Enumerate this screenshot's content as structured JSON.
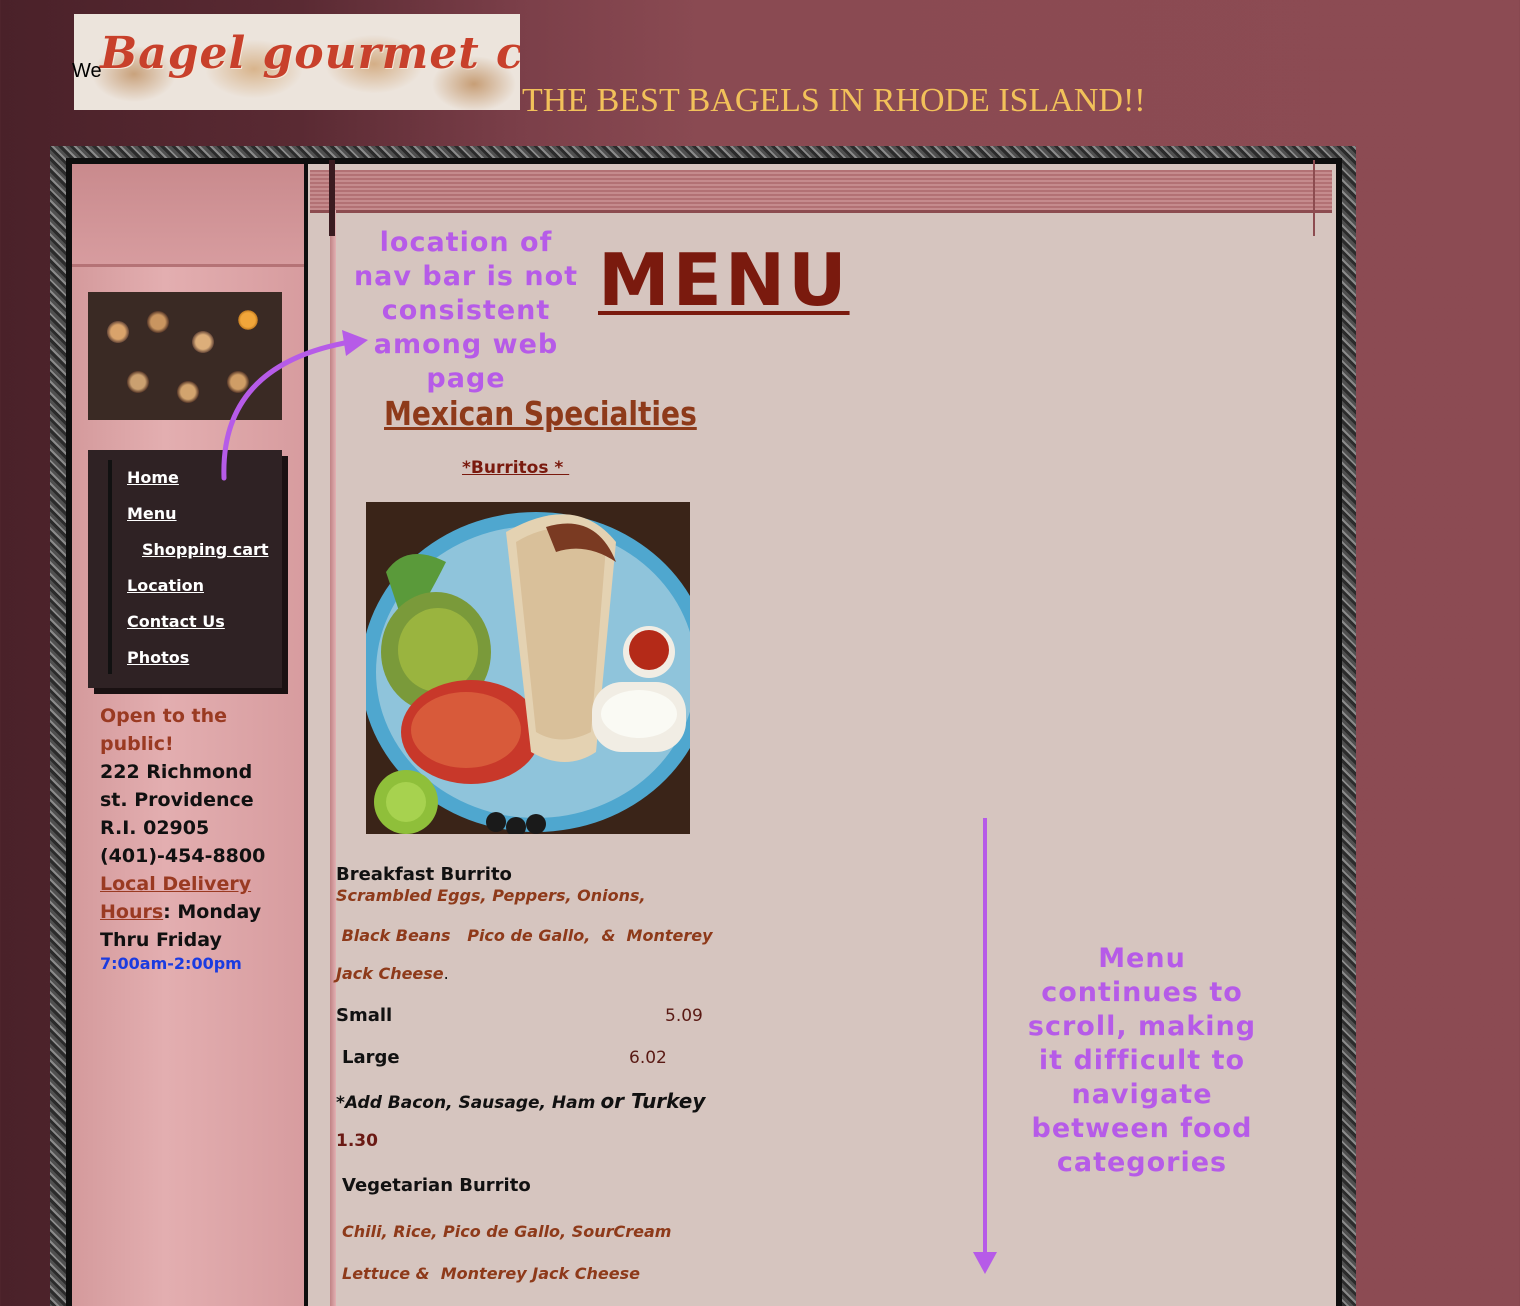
{
  "header": {
    "logo_text": "Bagel gourmet cafe",
    "we_text": "We",
    "tagline": "THE BEST BAGELS IN RHODE ISLAND!!"
  },
  "nav": {
    "items": [
      {
        "label": "Home"
      },
      {
        "label": "Menu"
      },
      {
        "label": "Shopping cart"
      },
      {
        "label": "Location"
      },
      {
        "label": "Contact Us"
      },
      {
        "label": "Photos"
      }
    ]
  },
  "sidebar": {
    "open_label": "Open to the public!",
    "address_1": "222 Richmond",
    "address_2": "st. Providence",
    "address_3": "R.I. 02905",
    "phone": "(401)-454-8800",
    "delivery_link": "Local Delivery Hours",
    "delivery_days": ": Monday Thru Friday",
    "hours": "7:00am-2:00pm"
  },
  "main": {
    "title": "MENU",
    "section_title": "Mexican Specialties",
    "subsection": "*Burritos * ",
    "items": [
      {
        "name": "Breakfast Burrito",
        "desc_1": "Scrambled Eggs, Peppers, Onions,",
        "desc_2": " Black Beans   Pico de Gallo,  &  Monterey",
        "desc_3": "Jack Cheese",
        "desc_3_suffix": ".",
        "size_small": "Small",
        "price_small": "5.09",
        "size_large": "Large",
        "price_large": "6.02",
        "addon": "*Add Bacon, Sausage, Ham",
        "addon_or": "or Turkey",
        "addon_price": "1.30"
      },
      {
        "name": "Vegetarian Burrito",
        "desc_1": "Chili, Rice, Pico de Gallo, SourCream",
        "desc_2": "Lettuce &  Monterey Jack Cheese"
      }
    ]
  },
  "annotations": {
    "nav_note": "location of nav bar is not consistent among web page",
    "scroll_note": "Menu continues to scroll, making it difficult to navigate between food categories",
    "color": "#b65be8"
  }
}
